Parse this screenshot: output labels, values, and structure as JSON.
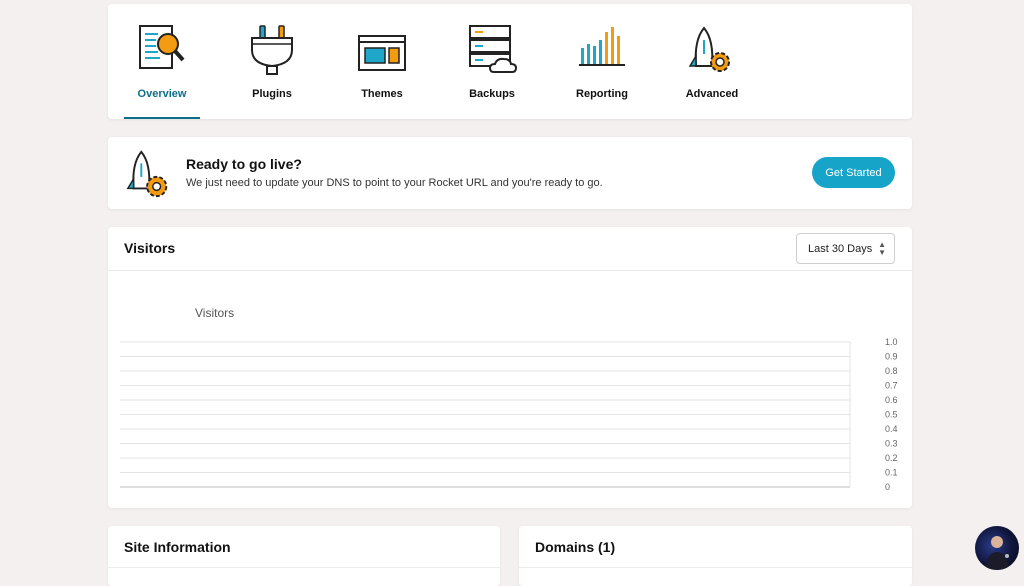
{
  "nav": {
    "tabs": [
      {
        "label": "Overview",
        "icon": "magnifier-document-icon",
        "active": true
      },
      {
        "label": "Plugins",
        "icon": "plug-icon",
        "active": false
      },
      {
        "label": "Themes",
        "icon": "browser-window-icon",
        "active": false
      },
      {
        "label": "Backups",
        "icon": "server-cloud-icon",
        "active": false
      },
      {
        "label": "Reporting",
        "icon": "bar-chart-icon",
        "active": false
      },
      {
        "label": "Advanced",
        "icon": "rocket-gear-icon",
        "active": false
      }
    ]
  },
  "go_live": {
    "title": "Ready to go live?",
    "description": "We just need to update your DNS to point to your Rocket URL and you're ready to go.",
    "button_label": "Get Started"
  },
  "visitors": {
    "title": "Visitors",
    "range_select": {
      "selected": "Last 30 Days"
    },
    "chart_data": {
      "type": "line",
      "title": "Visitors",
      "x": [],
      "series": [],
      "ylim": [
        0,
        1
      ],
      "y_ticks": [
        "1.0",
        "0.9",
        "0.8",
        "0.7",
        "0.6",
        "0.5",
        "0.4",
        "0.3",
        "0.2",
        "0.1",
        "0"
      ],
      "y_axis_side": "right",
      "grid": true
    }
  },
  "site_info": {
    "title": "Site Information"
  },
  "domains": {
    "title": "Domains (1)"
  },
  "colors": {
    "accent": "#0e6e8a",
    "button": "#16a5c9",
    "icon_orange": "#f39c12",
    "icon_blue": "#1fa6c9"
  }
}
